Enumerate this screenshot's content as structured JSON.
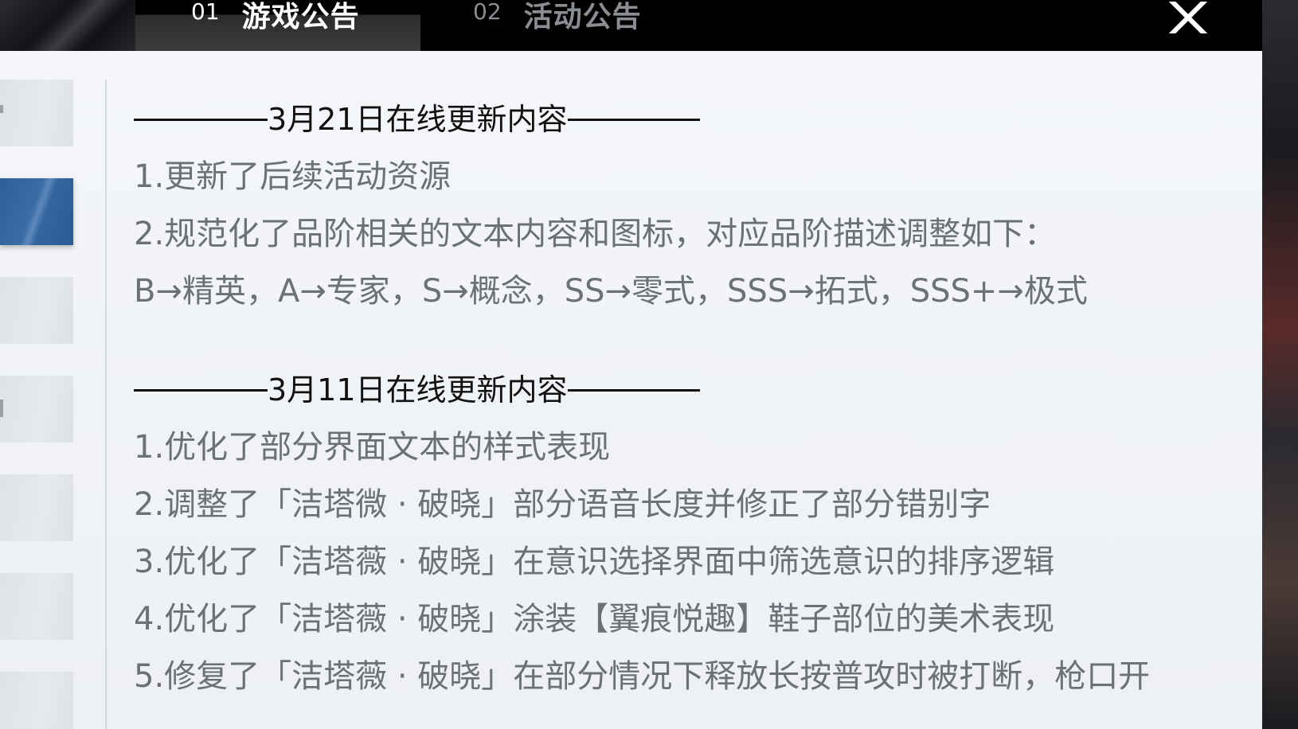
{
  "tabs": [
    {
      "num": "01",
      "label": "游戏公告"
    },
    {
      "num": "02",
      "label": "活动公告"
    }
  ],
  "colors": {
    "accent_blue": "#33659f",
    "text_gray": "#6c7077",
    "heading_black": "#111111"
  },
  "icons": {
    "close": "close-icon"
  },
  "sections": [
    {
      "heading": "3月21日在线更新内容",
      "items": [
        "1.更新了后续活动资源",
        "2.规范化了品阶相关的文本内容和图标，对应品阶描述调整如下：",
        "B→精英，A→专家，S→概念，SS→零式，SSS→拓式，SSS+→极式"
      ]
    },
    {
      "heading": "3月11日在线更新内容",
      "items": [
        "1.优化了部分界面文本的样式表现",
        "2.调整了「洁塔微 · 破晓」部分语音长度并修正了部分错别字",
        "3.优化了「洁塔薇 · 破晓」在意识选择界面中筛选意识的排序逻辑",
        "4.优化了「洁塔薇 · 破晓」涂装【翼痕悦趣】鞋子部位的美术表现",
        "5.修复了「洁塔薇 · 破晓」在部分情况下释放长按普攻时被打断，枪口开"
      ]
    }
  ]
}
